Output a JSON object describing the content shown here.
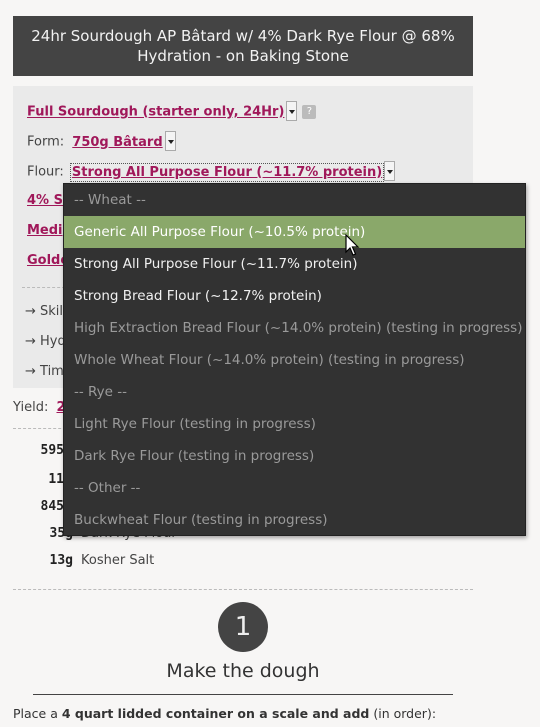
{
  "recipe_title": "24hr Sourdough AP Bâtard w/ 4% Dark Rye Flour @ 68% Hydration - on Baking Stone",
  "controls": {
    "method": "Full Sourdough (starter only, 24Hr)",
    "help": "?",
    "form_label": "Form:",
    "form_value": "750g Bâtard",
    "flour_label": "Flour:",
    "flour_value": "Strong All Purpose Flour (~11.7% protein)",
    "partial_1": "4% Se",
    "partial_2": "Medi",
    "partial_3": "Golde"
  },
  "side_list": [
    "→ Skil",
    "→ Hyd",
    "→ Tim"
  ],
  "yield": {
    "label": "Yield:",
    "value": "2"
  },
  "ingredients": [
    {
      "amount": "595",
      "name": ""
    },
    {
      "amount": "11",
      "name": ""
    },
    {
      "amount": "845",
      "name": ""
    },
    {
      "amount": "35g",
      "name": "Dark Rye Flour"
    },
    {
      "amount": "13g",
      "name": "Kosher Salt"
    }
  ],
  "step": {
    "number": "1",
    "title": "Make the dough",
    "text_before": "Place a ",
    "text_bold": "4 quart lidded container on a scale and add",
    "text_after": " (in order):"
  },
  "dropdown": {
    "options": [
      {
        "label": "-- Wheat --",
        "kind": "group"
      },
      {
        "label": "Generic All Purpose Flour (~10.5% protein)",
        "kind": "highlight"
      },
      {
        "label": "Strong All Purpose Flour (~11.7% protein)",
        "kind": "normal"
      },
      {
        "label": "Strong Bread Flour (~12.7% protein)",
        "kind": "normal"
      },
      {
        "label": "High Extraction Bread Flour (~14.0% protein) (testing in progress)",
        "kind": "disabled"
      },
      {
        "label": "Whole Wheat Flour (~14.0% protein) (testing in progress)",
        "kind": "disabled"
      },
      {
        "label": "-- Rye --",
        "kind": "group"
      },
      {
        "label": "Light Rye Flour (testing in progress)",
        "kind": "disabled"
      },
      {
        "label": "Dark Rye Flour (testing in progress)",
        "kind": "disabled"
      },
      {
        "label": "-- Other --",
        "kind": "group"
      },
      {
        "label": "Buckwheat Flour (testing in progress)",
        "kind": "disabled"
      }
    ]
  },
  "colors": {
    "title_bg": "#444444",
    "link": "#a0185a",
    "dropdown_bg": "#323232",
    "highlight": "#8aa86a"
  }
}
